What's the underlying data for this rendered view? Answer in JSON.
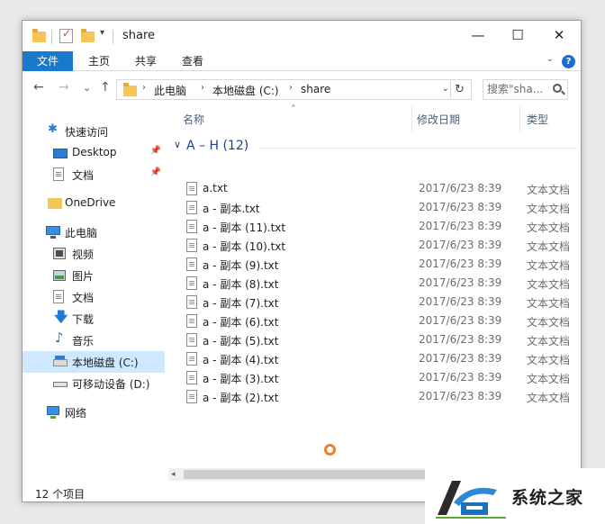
{
  "window": {
    "title": "share",
    "controls": {
      "minimize": "—",
      "maximize": "☐",
      "close": "✕"
    }
  },
  "ribbon": {
    "tabs": [
      "文件",
      "主页",
      "共享",
      "查看"
    ],
    "expand": "⌄",
    "help": "?"
  },
  "address": {
    "back": "←",
    "forward": "→",
    "recent": "⌄",
    "up": "↑",
    "crumbs": [
      "此电脑",
      "本地磁盘 (C:)",
      "share"
    ],
    "separator": "›",
    "dropdown": "⌄",
    "refresh": "↻"
  },
  "search": {
    "placeholder": "搜索\"sha..."
  },
  "sidebar": {
    "items": [
      {
        "label": "快速访问",
        "icon": "star-icon"
      },
      {
        "label": "Desktop",
        "icon": "desktop-icon",
        "pinned": true
      },
      {
        "label": "文档",
        "icon": "doc-icon",
        "pinned": true
      },
      {
        "label": "OneDrive",
        "icon": "onedrive-icon"
      },
      {
        "label": "此电脑",
        "icon": "pc-icon"
      },
      {
        "label": "视频",
        "icon": "video-icon"
      },
      {
        "label": "图片",
        "icon": "picture-icon"
      },
      {
        "label": "文档",
        "icon": "doc-icon"
      },
      {
        "label": "下载",
        "icon": "download-icon"
      },
      {
        "label": "音乐",
        "icon": "music-icon"
      },
      {
        "label": "本地磁盘 (C:)",
        "icon": "drive-icon",
        "selected": true
      },
      {
        "label": "可移动设备 (D:)",
        "icon": "usb-icon"
      },
      {
        "label": "网络",
        "icon": "network-icon"
      }
    ],
    "pin_glyph": "📌"
  },
  "columns": {
    "name": "名称",
    "modified": "修改日期",
    "type": "类型",
    "sort_glyph": "⌃"
  },
  "group": {
    "chevron": "∨",
    "title": "A – H (12)"
  },
  "files": [
    {
      "name": "a.txt",
      "modified": "2017/6/23 8:39",
      "type": "文本文档"
    },
    {
      "name": "a - 副本.txt",
      "modified": "2017/6/23 8:39",
      "type": "文本文档"
    },
    {
      "name": "a - 副本 (11).txt",
      "modified": "2017/6/23 8:39",
      "type": "文本文档"
    },
    {
      "name": "a - 副本 (10).txt",
      "modified": "2017/6/23 8:39",
      "type": "文本文档"
    },
    {
      "name": "a - 副本 (9).txt",
      "modified": "2017/6/23 8:39",
      "type": "文本文档"
    },
    {
      "name": "a - 副本 (8).txt",
      "modified": "2017/6/23 8:39",
      "type": "文本文档"
    },
    {
      "name": "a - 副本 (7).txt",
      "modified": "2017/6/23 8:39",
      "type": "文本文档"
    },
    {
      "name": "a - 副本 (6).txt",
      "modified": "2017/6/23 8:39",
      "type": "文本文档"
    },
    {
      "name": "a - 副本 (5).txt",
      "modified": "2017/6/23 8:39",
      "type": "文本文档"
    },
    {
      "name": "a - 副本 (4).txt",
      "modified": "2017/6/23 8:39",
      "type": "文本文档"
    },
    {
      "name": "a - 副本 (3).txt",
      "modified": "2017/6/23 8:39",
      "type": "文本文档"
    },
    {
      "name": "a - 副本 (2).txt",
      "modified": "2017/6/23 8:39",
      "type": "文本文档"
    }
  ],
  "scrollbar": {
    "left_arrow": "◂"
  },
  "status": {
    "count": "12 个项目"
  },
  "watermark": {
    "text": "系统之家"
  },
  "colors": {
    "accent": "#1979ca",
    "selected_bg": "#cde8ff",
    "group_title": "#1e3f91",
    "header_text": "#4c607a",
    "spinner": "#ef7d2a"
  }
}
